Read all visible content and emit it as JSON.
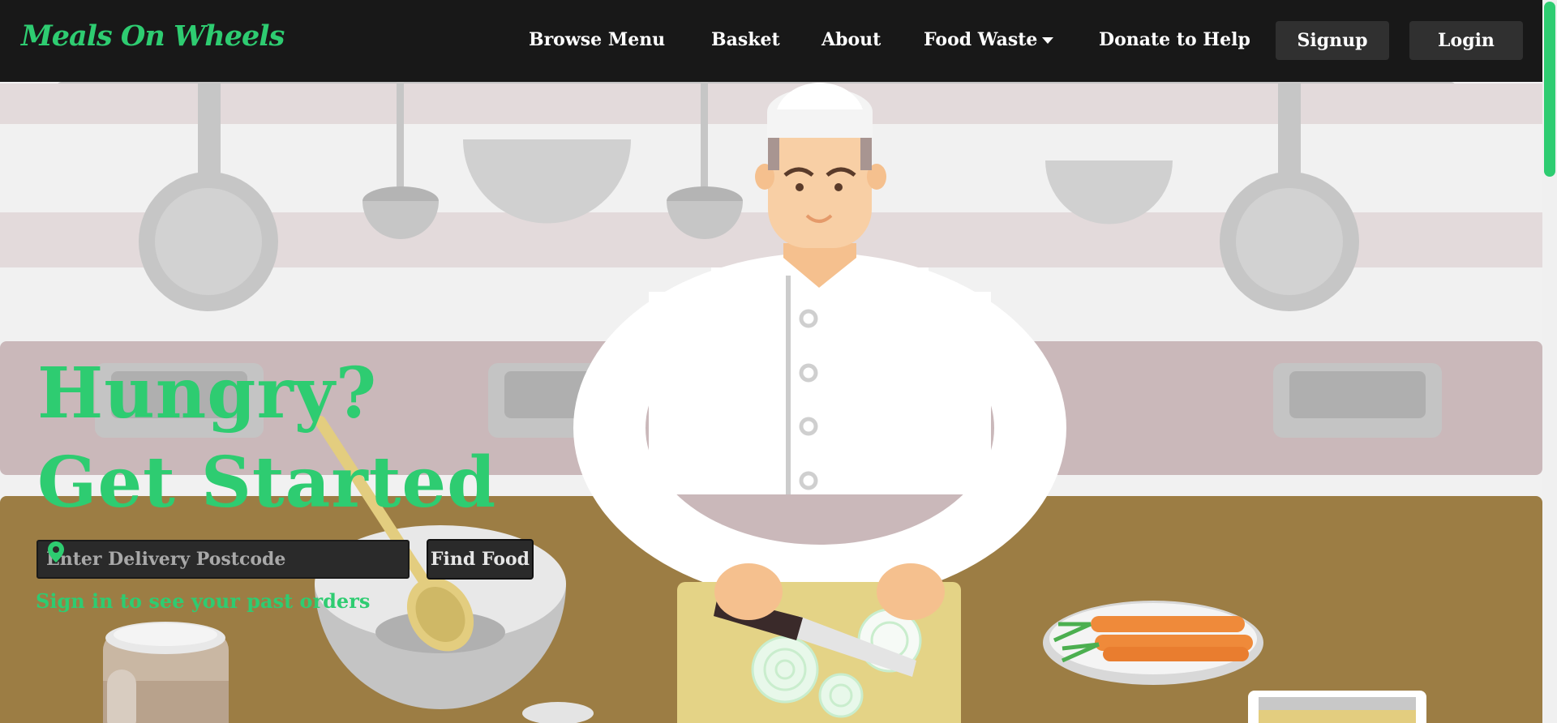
{
  "brand": {
    "name": "Meals On Wheels"
  },
  "nav": {
    "browse_menu": "Browse Menu",
    "basket": "Basket",
    "about": "About",
    "food_waste": "Food Waste",
    "donate": "Donate to Help",
    "signup": "Signup",
    "login": "Login"
  },
  "hero": {
    "line1": "Hungry?",
    "line2": "Get Started",
    "postcode_placeholder": "Enter Delivery Postcode",
    "find_button": "Find Food",
    "signin_link": "Sign in to see your past orders"
  },
  "colors": {
    "accent": "#2ecc71",
    "navbar": "#181818",
    "counter": "#9c7d44"
  },
  "icons": [
    "map-pin-icon",
    "caret-down-icon"
  ]
}
